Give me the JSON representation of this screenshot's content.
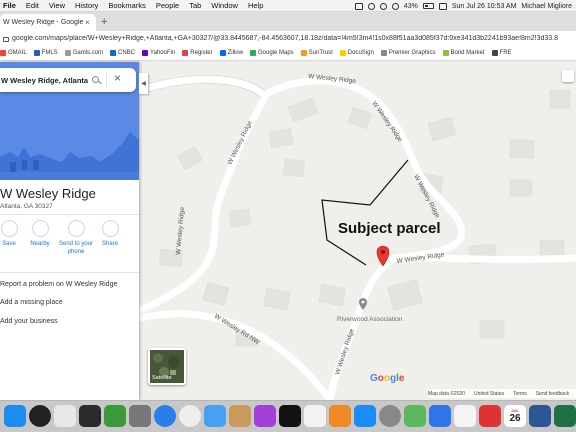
{
  "menubar": {
    "app": "File",
    "items": [
      "Edit",
      "View",
      "History",
      "Bookmarks",
      "People",
      "Tab",
      "Window",
      "Help"
    ],
    "battery": "43%",
    "datetime": "Sun Jul 26  10:53 AM",
    "user": "Michael Migliore"
  },
  "browser": {
    "tab_title": "W Wesley Ridge - Google Maps",
    "url": "google.com/maps/place/W+Wesley+Ridge,+Atlanta,+GA+30327/@33.8445687,-84.4563607,18.18z/data=!4m5!3m4!1s0x88f51aa3d085f37d:0xe341d3b2241b93ae!8m2!3d33.8",
    "bookmarks": [
      "GMAIL",
      "FMLS",
      "Gamls.com",
      "CNBC",
      "YahooFin",
      "Register",
      "Zillow",
      "Google Maps",
      "SunTrust",
      "DocuSign",
      "Premier Graphics",
      "Bond Market",
      "FRE"
    ]
  },
  "panel": {
    "search_value": "W Wesley Ridge, Atlanta, GA",
    "place_name": "W Wesley Ridge",
    "place_sub": "Atlanta, GA 30327",
    "actions": [
      "Save",
      "Nearby",
      "Send to your phone",
      "Share"
    ],
    "links": [
      "Report a problem on W Wesley Ridge",
      "Add a missing place",
      "Add your business"
    ]
  },
  "map": {
    "road_labels": [
      "W Wesley Ridge",
      "W Wesley Ridge",
      "W Wesley Ridge",
      "W Wesley Ridge",
      "W Wesley Ridge",
      "W Wesley Ridge",
      "W Wesley Rd NW",
      "W Wesley Ridge"
    ],
    "annotation": "Subject parcel",
    "poi": "Riverwood Association",
    "satellite_label": "Satellite",
    "logo": [
      "G",
      "o",
      "o",
      "g",
      "l",
      "e"
    ],
    "attribution": [
      "Map data ©2020",
      "United States",
      "Terms",
      "Send feedback"
    ],
    "pin_color": "#e53935"
  },
  "dock": {
    "apps": [
      "Finder",
      "HDR",
      "Photos",
      "Pixelmator",
      "Dreamweaver",
      "Preview",
      "Safari",
      "Chrome",
      "Mail",
      "Contacts",
      "Podcasts",
      "Apple TV",
      "Music",
      "Books",
      "App Store",
      "System Preferences",
      "Maps",
      "Dropbox",
      "Notes",
      "Calendar",
      "Word",
      "Excel",
      "Finder"
    ],
    "calendar_day": "26",
    "calendar_month": "JUL"
  }
}
